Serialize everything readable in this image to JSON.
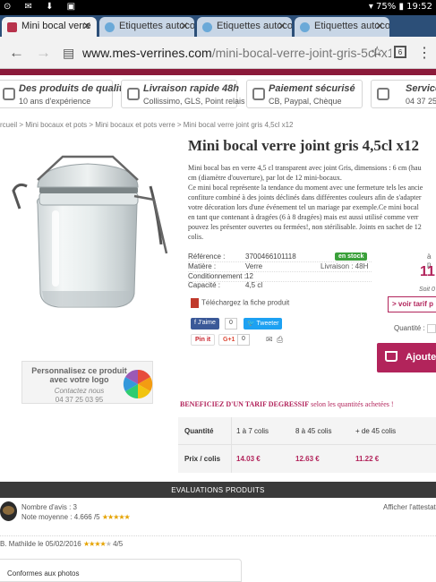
{
  "status_bar": {
    "battery": "75%",
    "time": "19:52"
  },
  "tabs": [
    {
      "label": "Mini bocal verre",
      "active": true
    },
    {
      "label": "Etiquettes autoco",
      "active": false
    },
    {
      "label": "Etiquettes autoco",
      "active": false
    },
    {
      "label": "Etiquettes autoco",
      "active": false
    }
  ],
  "address_bar": {
    "domain": "www.mes-verrines.com",
    "path": "/mini-bocal-verre-joint-gris-5cl-x1",
    "tab_count": "6"
  },
  "features": [
    {
      "title": "Des produits de qualité",
      "subtitle": "10 ans d'expérience",
      "icon": "thumbs-up-icon"
    },
    {
      "title": "Livraison rapide 48h",
      "subtitle": "Collissimo, GLS, Point relais",
      "icon": "truck-icon"
    },
    {
      "title": "Paiement sécurisé",
      "subtitle": "CB, Paypal, Chèque",
      "icon": "card-icon"
    },
    {
      "title": "Service c",
      "subtitle": "04 37 25",
      "icon": "phone-icon"
    }
  ],
  "breadcrumb": "rcueil > Mini bocaux et pots > Mini bocaux et pots verre > Mini bocal verre joint gris 4,5cl x12",
  "product": {
    "title": "Mini bocal verre joint gris 4,5cl x12",
    "description": [
      "Mini bocal bas en verre 4,5 cl transparent avec joint Gris, dimensions :  6 cm (hau",
      "cm (diamètre d'ouverture), par lot de 12 mini-bocaux.",
      "Ce mini bocal représente la tendance du moment avec une fermeture tels les ancie",
      "confiture combiné à des joints déclinés dans différentes couleurs afin de s'adapter",
      "votre décoration lors d'une événement tel un mariage par exemple.Ce mini bocal ",
      "en tant que contenant à dragées (6 à 8 dragées) mais est aussi utilisé comme verr",
      "pouvez les présenter ouvertes ou fermées!, non stérilisable. Joints en sachet de 12",
      "colis."
    ],
    "specs": [
      {
        "label": "Référence :",
        "value": "3700466101118"
      },
      {
        "label": "Matière :",
        "value": "Verre"
      },
      {
        "label": "Conditionnement :",
        "value": "12"
      },
      {
        "label": "Capacité :",
        "value": "4,5 cl"
      }
    ],
    "stock_badge": "en stock",
    "livraison": "Livraison : 48H",
    "download_label": "Téléchargez la fiche produit",
    "price_prefix": "à p",
    "price": "11",
    "soit": "Soit 0",
    "voir_tarif": "> voir tarif p",
    "quantite_label": "Quantité :",
    "add_to_cart": "Ajouter"
  },
  "social": {
    "facebook_label": "J'aime",
    "facebook_count": "0",
    "twitter_label": "Tweeter",
    "pinterest_label": "Pin it",
    "gplus_label": "G+1",
    "gplus_count": "0"
  },
  "custom_banner": {
    "line1": "Personnalisez ce produit",
    "line2": "avec votre logo",
    "line3": "Contactez nous",
    "line4": "04 37 25 03 95"
  },
  "degressive": {
    "heading_bold": "BENEFICIEZ D'UN TARIF DEGRESSIF",
    "heading_rest": "selon les quantités achetées !",
    "row1_label": "Quantité",
    "row2_label": "Prix / colis",
    "columns": [
      {
        "quantity": "1 à 7 colis",
        "price": "14.03 €"
      },
      {
        "quantity": "8 à 45 colis",
        "price": "12.63 €"
      },
      {
        "quantity": "+ de 45 colis",
        "price": "11.22 €"
      }
    ]
  },
  "evaluations": {
    "bar_title": "EVALUATIONS PRODUITS",
    "nombre_avis": "Nombre d'avis : 3",
    "note_moyenne": "Note moyenne : 4.666 /5",
    "attestation": "Afficher l'attestati",
    "reviewer": "B. Mathilde",
    "review_date": "le 05/02/2016",
    "review_score": "4/5",
    "review_text": "Conformes aux photos"
  },
  "colors": {
    "brand": "#b2245b",
    "tab_bar": "#2c4f78",
    "stock_green": "#3aa03a",
    "star": "#e5a300"
  }
}
